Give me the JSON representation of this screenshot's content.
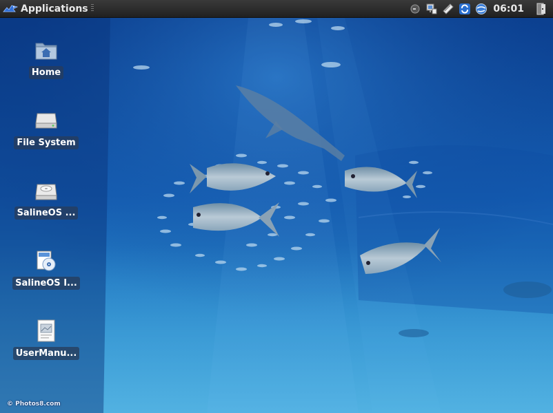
{
  "panel": {
    "menu_label": "Applications",
    "clock": "06:01",
    "tray_icons": [
      "volume-icon",
      "network-icon",
      "notes-icon",
      "update-icon",
      "browser-icon"
    ]
  },
  "desktop_icons": [
    {
      "label": "Home",
      "icon": "home-folder-icon"
    },
    {
      "label": "File System",
      "icon": "drive-icon"
    },
    {
      "label": "SalineOS ...",
      "icon": "optical-drive-icon"
    },
    {
      "label": "SalineOS I...",
      "icon": "installer-disc-icon"
    },
    {
      "label": "UserManu...",
      "icon": "document-icon"
    }
  ],
  "wallpaper": {
    "watermark": "© Photos8.com"
  },
  "colors": {
    "panel_bg": "#2a2a2a",
    "water_deep": "#0a3f8c",
    "water_light": "#3f9ed4"
  }
}
